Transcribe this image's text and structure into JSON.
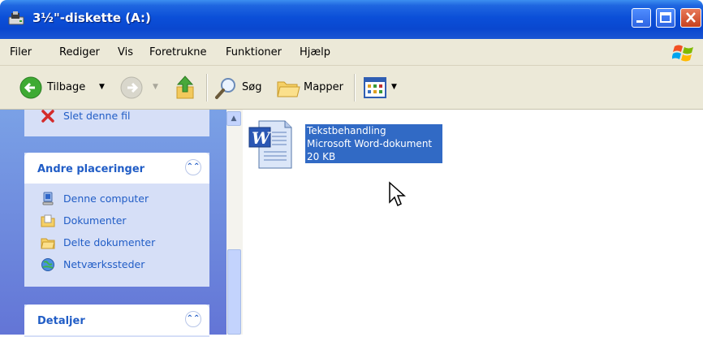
{
  "window": {
    "title": "3½\"-diskette (A:)",
    "title_icon": "floppy-drive-icon",
    "controls": [
      "minimize-icon",
      "maximize-icon",
      "close-icon"
    ]
  },
  "menu": {
    "items": [
      "Filer",
      "Rediger",
      "Vis",
      "Foretrukne",
      "Funktioner",
      "Hjælp"
    ]
  },
  "toolbar": {
    "back_label": "Tilbage",
    "search_label": "Søg",
    "folders_label": "Mapper"
  },
  "tasks": {
    "delete_label": "Slet denne fil"
  },
  "other_places": {
    "title": "Andre placeringer",
    "items": [
      {
        "label": "Denne computer",
        "icon": "my-computer-icon"
      },
      {
        "label": "Dokumenter",
        "icon": "documents-folder-icon"
      },
      {
        "label": "Delte dokumenter",
        "icon": "shared-folder-icon"
      },
      {
        "label": "Netværkssteder",
        "icon": "network-places-icon"
      }
    ]
  },
  "details": {
    "title": "Detaljer"
  },
  "file": {
    "name": "Tekstbehandling",
    "type": "Microsoft Word-dokument",
    "size": "20 KB",
    "icon": "word-document-icon"
  },
  "colors": {
    "titlebar": "#0b4fd8",
    "link": "#215dc6",
    "selection": "#316ac5",
    "taskpane": "#6f8fe0"
  }
}
